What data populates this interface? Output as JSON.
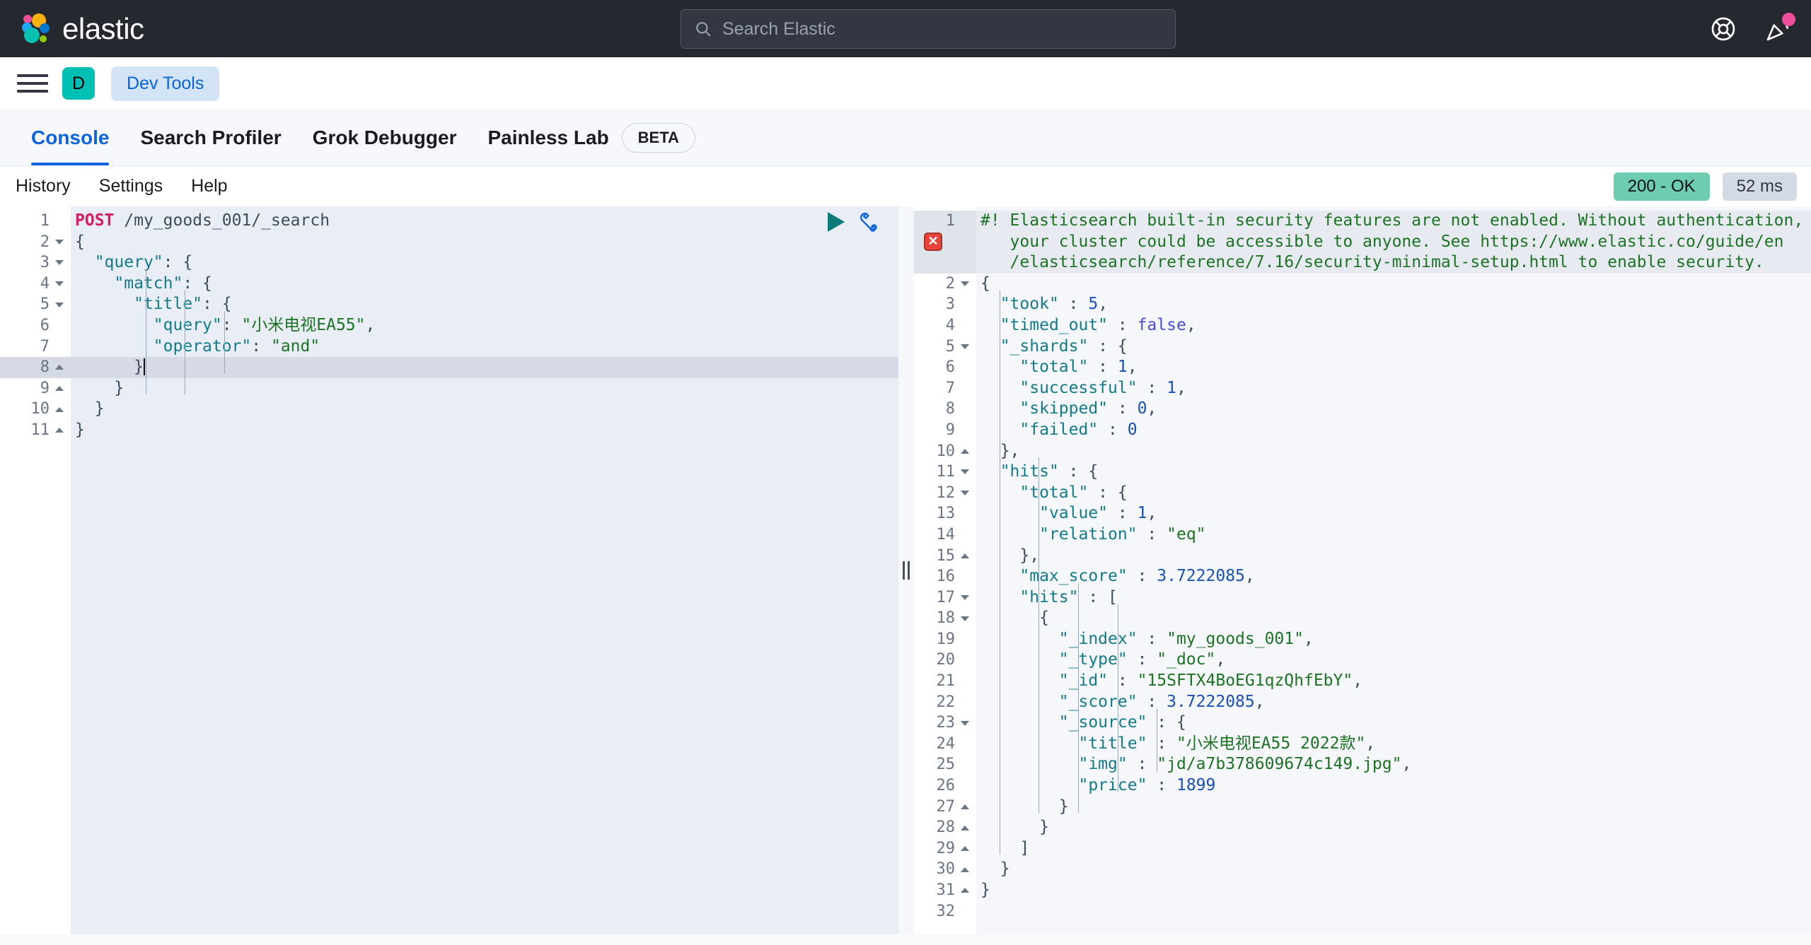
{
  "header": {
    "brand_name": "elastic",
    "brand_logo_icon": "elastic-logo-icon",
    "search": {
      "placeholder": "Search Elastic",
      "value": "",
      "icon": "search-icon"
    },
    "help_icon": "lifebuoy-help-icon",
    "whatsnew_icon": "party-popper-icon",
    "notification_dot_color": "#f04e98",
    "background_color": "#25282f"
  },
  "navbar": {
    "menu_icon": "hamburger-menu-icon",
    "space_avatar_label": "D",
    "space_avatar_color": "#00bfb3",
    "breadcrumb_label": "Dev Tools"
  },
  "app_tabs": [
    {
      "label": "Console",
      "active": true,
      "badge": ""
    },
    {
      "label": "Search Profiler",
      "active": false,
      "badge": ""
    },
    {
      "label": "Grok Debugger",
      "active": false,
      "badge": ""
    },
    {
      "label": "Painless Lab",
      "active": false,
      "badge": "BETA"
    }
  ],
  "console_toolbar": {
    "links": [
      "History",
      "Settings",
      "Help"
    ],
    "status_code": "200 - OK",
    "status_color": "#6dccb1",
    "elapsed": "52 ms"
  },
  "request_editor": {
    "play_icon": "play-run-icon",
    "wrench_icon": "wrench-actions-icon",
    "active_line": 8,
    "lines": [
      {
        "n": 1,
        "fold": "none",
        "tokens": [
          {
            "c": "t-method",
            "t": "POST"
          },
          {
            "c": "t-plain",
            "t": " "
          },
          {
            "c": "t-url",
            "t": "/my_goods_001/_search"
          }
        ]
      },
      {
        "n": 2,
        "fold": "down",
        "tokens": [
          {
            "c": "t-punct",
            "t": "{"
          }
        ]
      },
      {
        "n": 3,
        "fold": "down",
        "tokens": [
          {
            "c": "t-plain",
            "t": "  "
          },
          {
            "c": "t-key",
            "t": "\"query\""
          },
          {
            "c": "t-punct",
            "t": ": {"
          }
        ]
      },
      {
        "n": 4,
        "fold": "down",
        "tokens": [
          {
            "c": "t-plain",
            "t": "    "
          },
          {
            "c": "t-key",
            "t": "\"match\""
          },
          {
            "c": "t-punct",
            "t": ": {"
          }
        ]
      },
      {
        "n": 5,
        "fold": "down",
        "tokens": [
          {
            "c": "t-plain",
            "t": "      "
          },
          {
            "c": "t-key",
            "t": "\"title\""
          },
          {
            "c": "t-punct",
            "t": ": {"
          }
        ]
      },
      {
        "n": 6,
        "fold": "none",
        "tokens": [
          {
            "c": "t-plain",
            "t": "        "
          },
          {
            "c": "t-key",
            "t": "\"query\""
          },
          {
            "c": "t-punct",
            "t": ": "
          },
          {
            "c": "t-str",
            "t": "\"小米电视EA55\""
          },
          {
            "c": "t-punct",
            "t": ","
          }
        ]
      },
      {
        "n": 7,
        "fold": "none",
        "tokens": [
          {
            "c": "t-plain",
            "t": "        "
          },
          {
            "c": "t-key",
            "t": "\"operator\""
          },
          {
            "c": "t-punct",
            "t": ": "
          },
          {
            "c": "t-str",
            "t": "\"and\""
          }
        ]
      },
      {
        "n": 8,
        "fold": "up",
        "tokens": [
          {
            "c": "t-plain",
            "t": "      "
          },
          {
            "c": "t-punct",
            "t": "}"
          }
        ]
      },
      {
        "n": 9,
        "fold": "up",
        "tokens": [
          {
            "c": "t-plain",
            "t": "    "
          },
          {
            "c": "t-punct",
            "t": "}"
          }
        ]
      },
      {
        "n": 10,
        "fold": "up",
        "tokens": [
          {
            "c": "t-plain",
            "t": "  "
          },
          {
            "c": "t-punct",
            "t": "}"
          }
        ]
      },
      {
        "n": 11,
        "fold": "up",
        "tokens": [
          {
            "c": "t-punct",
            "t": "}"
          }
        ]
      }
    ]
  },
  "response_editor": {
    "error_marker_icon": "error-x-icon",
    "error_marker_line": 1,
    "lines": [
      {
        "n": 1,
        "fold": "none",
        "tokens": [
          {
            "c": "t-comment",
            "t": "#! Elasticsearch built-in security features are not enabled. Without authentication,"
          }
        ]
      },
      {
        "n": "",
        "fold": "none",
        "tokens": [
          {
            "c": "t-comment",
            "t": "   your cluster could be accessible to anyone. See https://www.elastic.co/guide/en"
          }
        ]
      },
      {
        "n": "",
        "fold": "none",
        "tokens": [
          {
            "c": "t-comment",
            "t": "   /elasticsearch/reference/7.16/security-minimal-setup.html to enable security."
          }
        ]
      },
      {
        "n": 2,
        "fold": "down",
        "tokens": [
          {
            "c": "t-punct",
            "t": "{"
          }
        ]
      },
      {
        "n": 3,
        "fold": "none",
        "tokens": [
          {
            "c": "t-plain",
            "t": "  "
          },
          {
            "c": "t-key",
            "t": "\"took\""
          },
          {
            "c": "t-punct",
            "t": " : "
          },
          {
            "c": "t-num",
            "t": "5"
          },
          {
            "c": "t-punct",
            "t": ","
          }
        ]
      },
      {
        "n": 4,
        "fold": "none",
        "tokens": [
          {
            "c": "t-plain",
            "t": "  "
          },
          {
            "c": "t-key",
            "t": "\"timed_out\""
          },
          {
            "c": "t-punct",
            "t": " : "
          },
          {
            "c": "t-bool",
            "t": "false"
          },
          {
            "c": "t-punct",
            "t": ","
          }
        ]
      },
      {
        "n": 5,
        "fold": "down",
        "tokens": [
          {
            "c": "t-plain",
            "t": "  "
          },
          {
            "c": "t-key",
            "t": "\"_shards\""
          },
          {
            "c": "t-punct",
            "t": " : {"
          }
        ]
      },
      {
        "n": 6,
        "fold": "none",
        "tokens": [
          {
            "c": "t-plain",
            "t": "    "
          },
          {
            "c": "t-key",
            "t": "\"total\""
          },
          {
            "c": "t-punct",
            "t": " : "
          },
          {
            "c": "t-num",
            "t": "1"
          },
          {
            "c": "t-punct",
            "t": ","
          }
        ]
      },
      {
        "n": 7,
        "fold": "none",
        "tokens": [
          {
            "c": "t-plain",
            "t": "    "
          },
          {
            "c": "t-key",
            "t": "\"successful\""
          },
          {
            "c": "t-punct",
            "t": " : "
          },
          {
            "c": "t-num",
            "t": "1"
          },
          {
            "c": "t-punct",
            "t": ","
          }
        ]
      },
      {
        "n": 8,
        "fold": "none",
        "tokens": [
          {
            "c": "t-plain",
            "t": "    "
          },
          {
            "c": "t-key",
            "t": "\"skipped\""
          },
          {
            "c": "t-punct",
            "t": " : "
          },
          {
            "c": "t-num",
            "t": "0"
          },
          {
            "c": "t-punct",
            "t": ","
          }
        ]
      },
      {
        "n": 9,
        "fold": "none",
        "tokens": [
          {
            "c": "t-plain",
            "t": "    "
          },
          {
            "c": "t-key",
            "t": "\"failed\""
          },
          {
            "c": "t-punct",
            "t": " : "
          },
          {
            "c": "t-num",
            "t": "0"
          }
        ]
      },
      {
        "n": 10,
        "fold": "up",
        "tokens": [
          {
            "c": "t-plain",
            "t": "  "
          },
          {
            "c": "t-punct",
            "t": "},"
          }
        ]
      },
      {
        "n": 11,
        "fold": "down",
        "tokens": [
          {
            "c": "t-plain",
            "t": "  "
          },
          {
            "c": "t-key",
            "t": "\"hits\""
          },
          {
            "c": "t-punct",
            "t": " : {"
          }
        ]
      },
      {
        "n": 12,
        "fold": "down",
        "tokens": [
          {
            "c": "t-plain",
            "t": "    "
          },
          {
            "c": "t-key",
            "t": "\"total\""
          },
          {
            "c": "t-punct",
            "t": " : {"
          }
        ]
      },
      {
        "n": 13,
        "fold": "none",
        "tokens": [
          {
            "c": "t-plain",
            "t": "      "
          },
          {
            "c": "t-key",
            "t": "\"value\""
          },
          {
            "c": "t-punct",
            "t": " : "
          },
          {
            "c": "t-num",
            "t": "1"
          },
          {
            "c": "t-punct",
            "t": ","
          }
        ]
      },
      {
        "n": 14,
        "fold": "none",
        "tokens": [
          {
            "c": "t-plain",
            "t": "      "
          },
          {
            "c": "t-key",
            "t": "\"relation\""
          },
          {
            "c": "t-punct",
            "t": " : "
          },
          {
            "c": "t-str",
            "t": "\"eq\""
          }
        ]
      },
      {
        "n": 15,
        "fold": "up",
        "tokens": [
          {
            "c": "t-plain",
            "t": "    "
          },
          {
            "c": "t-punct",
            "t": "},"
          }
        ]
      },
      {
        "n": 16,
        "fold": "none",
        "tokens": [
          {
            "c": "t-plain",
            "t": "    "
          },
          {
            "c": "t-key",
            "t": "\"max_score\""
          },
          {
            "c": "t-punct",
            "t": " : "
          },
          {
            "c": "t-num",
            "t": "3.7222085"
          },
          {
            "c": "t-punct",
            "t": ","
          }
        ]
      },
      {
        "n": 17,
        "fold": "down",
        "tokens": [
          {
            "c": "t-plain",
            "t": "    "
          },
          {
            "c": "t-key",
            "t": "\"hits\""
          },
          {
            "c": "t-punct",
            "t": " : ["
          }
        ]
      },
      {
        "n": 18,
        "fold": "down",
        "tokens": [
          {
            "c": "t-plain",
            "t": "      "
          },
          {
            "c": "t-punct",
            "t": "{"
          }
        ]
      },
      {
        "n": 19,
        "fold": "none",
        "tokens": [
          {
            "c": "t-plain",
            "t": "        "
          },
          {
            "c": "t-key",
            "t": "\"_index\""
          },
          {
            "c": "t-punct",
            "t": " : "
          },
          {
            "c": "t-str",
            "t": "\"my_goods_001\""
          },
          {
            "c": "t-punct",
            "t": ","
          }
        ]
      },
      {
        "n": 20,
        "fold": "none",
        "tokens": [
          {
            "c": "t-plain",
            "t": "        "
          },
          {
            "c": "t-key",
            "t": "\"_type\""
          },
          {
            "c": "t-punct",
            "t": " : "
          },
          {
            "c": "t-str",
            "t": "\"_doc\""
          },
          {
            "c": "t-punct",
            "t": ","
          }
        ]
      },
      {
        "n": 21,
        "fold": "none",
        "tokens": [
          {
            "c": "t-plain",
            "t": "        "
          },
          {
            "c": "t-key",
            "t": "\"_id\""
          },
          {
            "c": "t-punct",
            "t": " : "
          },
          {
            "c": "t-str",
            "t": "\"15SFTX4BoEG1qzQhfEbY\""
          },
          {
            "c": "t-punct",
            "t": ","
          }
        ]
      },
      {
        "n": 22,
        "fold": "none",
        "tokens": [
          {
            "c": "t-plain",
            "t": "        "
          },
          {
            "c": "t-key",
            "t": "\"_score\""
          },
          {
            "c": "t-punct",
            "t": " : "
          },
          {
            "c": "t-num",
            "t": "3.7222085"
          },
          {
            "c": "t-punct",
            "t": ","
          }
        ]
      },
      {
        "n": 23,
        "fold": "down",
        "tokens": [
          {
            "c": "t-plain",
            "t": "        "
          },
          {
            "c": "t-key",
            "t": "\"_source\""
          },
          {
            "c": "t-punct",
            "t": " : {"
          }
        ]
      },
      {
        "n": 24,
        "fold": "none",
        "tokens": [
          {
            "c": "t-plain",
            "t": "          "
          },
          {
            "c": "t-key",
            "t": "\"title\""
          },
          {
            "c": "t-punct",
            "t": " : "
          },
          {
            "c": "t-str",
            "t": "\"小米电视EA55 2022款\""
          },
          {
            "c": "t-punct",
            "t": ","
          }
        ]
      },
      {
        "n": 25,
        "fold": "none",
        "tokens": [
          {
            "c": "t-plain",
            "t": "          "
          },
          {
            "c": "t-key",
            "t": "\"img\""
          },
          {
            "c": "t-punct",
            "t": " : "
          },
          {
            "c": "t-str",
            "t": "\"jd/a7b378609674c149.jpg\""
          },
          {
            "c": "t-punct",
            "t": ","
          }
        ]
      },
      {
        "n": 26,
        "fold": "none",
        "tokens": [
          {
            "c": "t-plain",
            "t": "          "
          },
          {
            "c": "t-key",
            "t": "\"price\""
          },
          {
            "c": "t-punct",
            "t": " : "
          },
          {
            "c": "t-num",
            "t": "1899"
          }
        ]
      },
      {
        "n": 27,
        "fold": "up",
        "tokens": [
          {
            "c": "t-plain",
            "t": "        "
          },
          {
            "c": "t-punct",
            "t": "}"
          }
        ]
      },
      {
        "n": 28,
        "fold": "up",
        "tokens": [
          {
            "c": "t-plain",
            "t": "      "
          },
          {
            "c": "t-punct",
            "t": "}"
          }
        ]
      },
      {
        "n": 29,
        "fold": "up",
        "tokens": [
          {
            "c": "t-plain",
            "t": "    "
          },
          {
            "c": "t-punct",
            "t": "]"
          }
        ]
      },
      {
        "n": 30,
        "fold": "up",
        "tokens": [
          {
            "c": "t-plain",
            "t": "  "
          },
          {
            "c": "t-punct",
            "t": "}"
          }
        ]
      },
      {
        "n": 31,
        "fold": "up",
        "tokens": [
          {
            "c": "t-punct",
            "t": "}"
          }
        ]
      },
      {
        "n": 32,
        "fold": "none",
        "tokens": []
      }
    ]
  },
  "splitter": {
    "icon": "vertical-resize-handle-icon"
  }
}
